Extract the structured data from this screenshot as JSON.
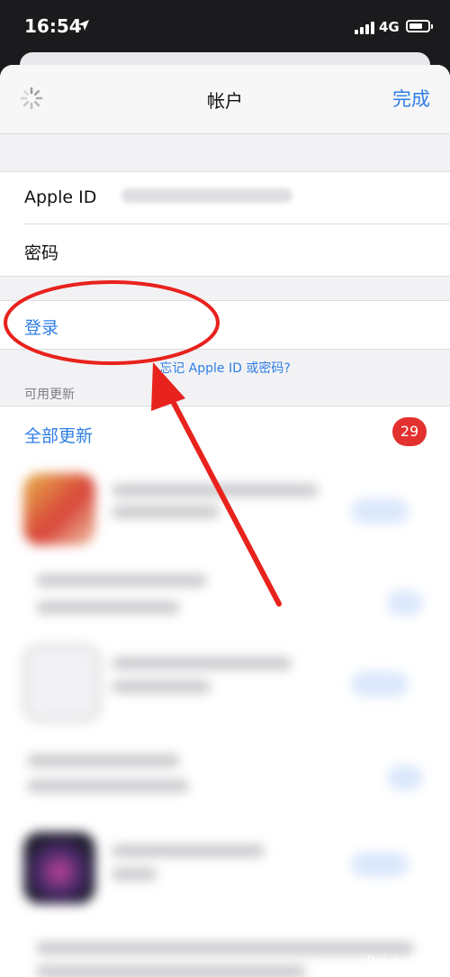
{
  "status_bar": {
    "time": "16:54",
    "network": "4G",
    "icons": [
      "location-arrow-icon",
      "signal-icon",
      "battery-icon"
    ]
  },
  "nav": {
    "title": "帐户",
    "done_label": "完成",
    "spinner_icon": "spinner-icon"
  },
  "account_form": {
    "apple_id_label": "Apple ID",
    "password_label": "密码"
  },
  "sign_in": {
    "label": "登录",
    "forgot_link": "忘记 Apple ID 或密码?"
  },
  "updates": {
    "section_header": "可用更新",
    "update_all_label": "全部更新",
    "badge_count": "29"
  },
  "colors": {
    "accent": "#2e7ee6",
    "badge": "#e3312f",
    "annotation": "#e8221d"
  }
}
